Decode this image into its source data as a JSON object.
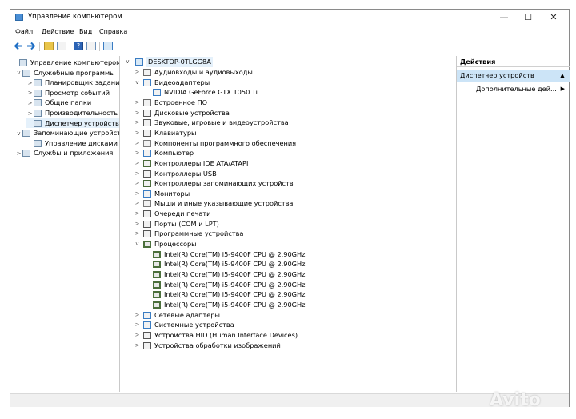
{
  "window": {
    "title": "Управление компьютером",
    "controls": {
      "minimize": "—",
      "maximize": "☐",
      "close": "✕"
    }
  },
  "menu": [
    "Файл",
    "Действие",
    "Вид",
    "Справка"
  ],
  "left_tree": [
    {
      "label": "Управление компьютером (л",
      "icon": "computer-management-icon",
      "arrow": "",
      "level": 0
    },
    {
      "label": "Служебные программы",
      "icon": "tools-icon",
      "arrow": "v",
      "level": 1
    },
    {
      "label": "Планировщик заданий",
      "icon": "clock-icon",
      "arrow": ">",
      "level": 2
    },
    {
      "label": "Просмотр событий",
      "icon": "event-viewer-icon",
      "arrow": ">",
      "level": 2
    },
    {
      "label": "Общие папки",
      "icon": "shared-folder-icon",
      "arrow": ">",
      "level": 2
    },
    {
      "label": "Производительность",
      "icon": "no-entry-icon",
      "arrow": ">",
      "level": 2
    },
    {
      "label": "Диспетчер устройств",
      "icon": "device-manager-icon",
      "arrow": "",
      "level": 2,
      "selected": true
    },
    {
      "label": "Запоминающие устройст",
      "icon": "storage-icon",
      "arrow": "v",
      "level": 1
    },
    {
      "label": "Управление дисками",
      "icon": "disk-management-icon",
      "arrow": "",
      "level": 2
    },
    {
      "label": "Службы и приложения",
      "icon": "services-icon",
      "arrow": ">",
      "level": 1
    }
  ],
  "device_tree": {
    "root": "DESKTOP-0TLGG8A",
    "rows": [
      {
        "label": "Аудиовходы и аудиовыходы",
        "arrow": ">",
        "level": 1,
        "icon": "audio-io-icon",
        "color": "#6b6b6b"
      },
      {
        "label": "Видеоадаптеры",
        "arrow": "v",
        "level": 1,
        "icon": "display-adapter-icon",
        "color": "#3a7cc2"
      },
      {
        "label": "NVIDIA GeForce GTX 1050 Ti",
        "arrow": "",
        "level": 2,
        "icon": "display-adapter-icon",
        "color": "#3a7cc2"
      },
      {
        "label": "Встроенное ПО",
        "arrow": ">",
        "level": 1,
        "icon": "firmware-icon",
        "color": "#6b6b6b"
      },
      {
        "label": "Дисковые устройства",
        "arrow": ">",
        "level": 1,
        "icon": "disk-drive-icon",
        "color": "#555555"
      },
      {
        "label": "Звуковые, игровые и видеоустройства",
        "arrow": ">",
        "level": 1,
        "icon": "speaker-icon",
        "color": "#555555"
      },
      {
        "label": "Клавиатуры",
        "arrow": ">",
        "level": 1,
        "icon": "keyboard-icon",
        "color": "#555555"
      },
      {
        "label": "Компоненты программного обеспечения",
        "arrow": ">",
        "level": 1,
        "icon": "software-component-icon",
        "color": "#7a7a7a"
      },
      {
        "label": "Компьютер",
        "arrow": ">",
        "level": 1,
        "icon": "computer-icon",
        "color": "#3a7cc2"
      },
      {
        "label": "Контроллеры IDE ATA/ATAPI",
        "arrow": ">",
        "level": 1,
        "icon": "ide-controller-icon",
        "color": "#4a6a3a"
      },
      {
        "label": "Контроллеры USB",
        "arrow": ">",
        "level": 1,
        "icon": "usb-icon",
        "color": "#555555"
      },
      {
        "label": "Контроллеры запоминающих устройств",
        "arrow": ">",
        "level": 1,
        "icon": "storage-controller-icon",
        "color": "#4a6a3a"
      },
      {
        "label": "Мониторы",
        "arrow": ">",
        "level": 1,
        "icon": "monitor-icon",
        "color": "#3a7cc2"
      },
      {
        "label": "Мыши и иные указывающие устройства",
        "arrow": ">",
        "level": 1,
        "icon": "mouse-icon",
        "color": "#777777"
      },
      {
        "label": "Очереди печати",
        "arrow": ">",
        "level": 1,
        "icon": "printer-icon",
        "color": "#555555"
      },
      {
        "label": "Порты (COM и LPT)",
        "arrow": ">",
        "level": 1,
        "icon": "port-icon",
        "color": "#555555"
      },
      {
        "label": "Программные устройства",
        "arrow": ">",
        "level": 1,
        "icon": "software-device-icon",
        "color": "#555555"
      },
      {
        "label": "Процессоры",
        "arrow": "v",
        "level": 1,
        "icon": "processor-icon",
        "color": "#4b6f3c"
      },
      {
        "label": "Intel(R) Core(TM) i5-9400F CPU @ 2.90GHz",
        "arrow": "",
        "level": 2,
        "icon": "processor-icon",
        "color": "#4b6f3c"
      },
      {
        "label": "Intel(R) Core(TM) i5-9400F CPU @ 2.90GHz",
        "arrow": "",
        "level": 2,
        "icon": "processor-icon",
        "color": "#4b6f3c"
      },
      {
        "label": "Intel(R) Core(TM) i5-9400F CPU @ 2.90GHz",
        "arrow": "",
        "level": 2,
        "icon": "processor-icon",
        "color": "#4b6f3c"
      },
      {
        "label": "Intel(R) Core(TM) i5-9400F CPU @ 2.90GHz",
        "arrow": "",
        "level": 2,
        "icon": "processor-icon",
        "color": "#4b6f3c"
      },
      {
        "label": "Intel(R) Core(TM) i5-9400F CPU @ 2.90GHz",
        "arrow": "",
        "level": 2,
        "icon": "processor-icon",
        "color": "#4b6f3c"
      },
      {
        "label": "Intel(R) Core(TM) i5-9400F CPU @ 2.90GHz",
        "arrow": "",
        "level": 2,
        "icon": "processor-icon",
        "color": "#4b6f3c"
      },
      {
        "label": "Сетевые адаптеры",
        "arrow": ">",
        "level": 1,
        "icon": "network-adapter-icon",
        "color": "#3a7cc2"
      },
      {
        "label": "Системные устройства",
        "arrow": ">",
        "level": 1,
        "icon": "system-device-icon",
        "color": "#3a7cc2"
      },
      {
        "label": "Устройства HID (Human Interface Devices)",
        "arrow": ">",
        "level": 1,
        "icon": "hid-icon",
        "color": "#555555"
      },
      {
        "label": "Устройства обработки изображений",
        "arrow": ">",
        "level": 1,
        "icon": "camera-icon",
        "color": "#555555"
      }
    ]
  },
  "actions": {
    "header": "Действия",
    "selected": "Диспетчер устройств",
    "item": "Дополнительные дей..."
  },
  "colors": {
    "selection": "#cce4f7",
    "accent": "#3a7cc2"
  },
  "watermark": "Avito"
}
